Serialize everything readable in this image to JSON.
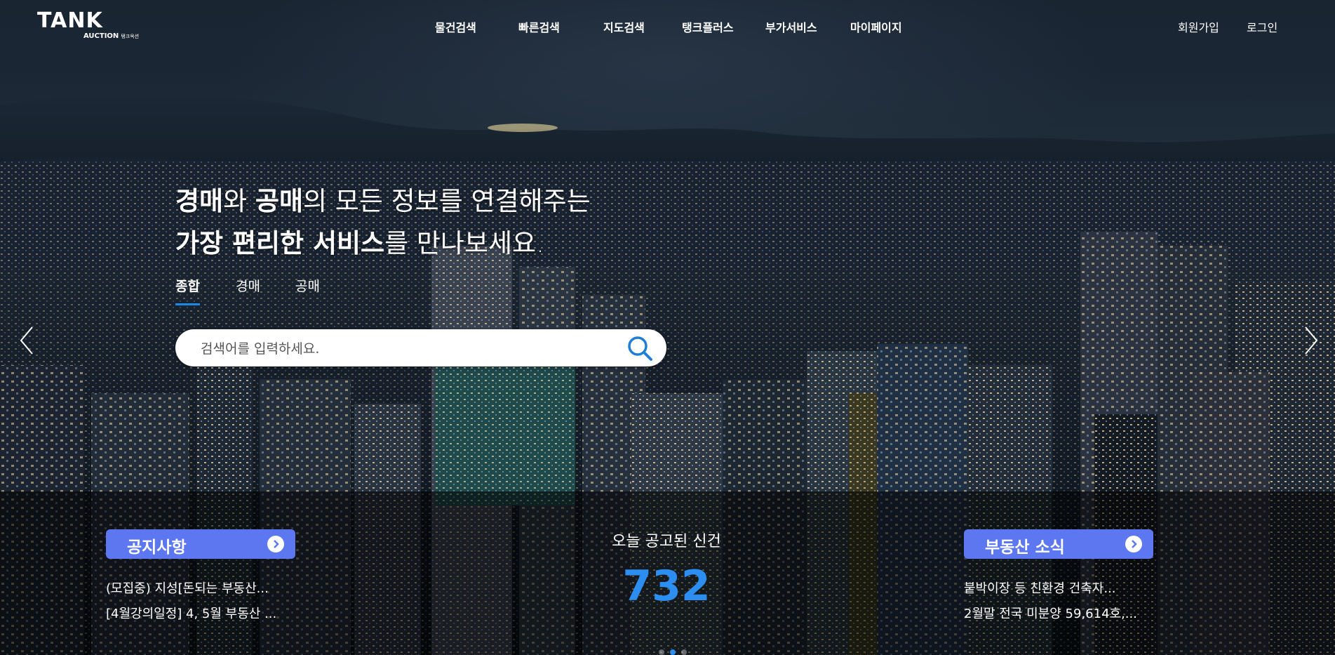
{
  "header": {
    "logo_main": "TANK",
    "logo_sub": "AUCTION",
    "logo_sub_ko": "탱크옥션",
    "nav": [
      "물건검색",
      "빠른검색",
      "지도검색",
      "탱크플러스",
      "부가서비스",
      "마이페이지"
    ],
    "signup": "회원가입",
    "login": "로그인"
  },
  "hero": {
    "line1_b1": "경매",
    "line1_t1": "와 ",
    "line1_b2": "공매",
    "line1_t2": "의 모든 정보를 연결해주는",
    "line2_b": "가장 편리한 서비스",
    "line2_t": "를 만나보세요."
  },
  "tabs": [
    "종합",
    "경매",
    "공매"
  ],
  "search": {
    "placeholder": "검색어를 입력하세요."
  },
  "notice": {
    "title": "공지사항",
    "items": [
      "(모집중) 지성[돈되는 부동산...",
      "[4월강의일정] 4, 5월 부동산 ..."
    ]
  },
  "today": {
    "label": "오늘 공고된 신건",
    "count": "732"
  },
  "realestate": {
    "title": "부동산 소식",
    "items": [
      "붙박이장 등 친환경 건축자...",
      "2월말 전국 미분양 59,614호,..."
    ]
  },
  "colors": {
    "accent": "#5d77f0",
    "count": "#2b8ef0",
    "tab_underline": "#1e88e5"
  },
  "icons": {
    "search": "search-icon",
    "prev": "chevron-left-icon",
    "next": "chevron-right-icon",
    "more": "chevron-right-circle-icon"
  }
}
